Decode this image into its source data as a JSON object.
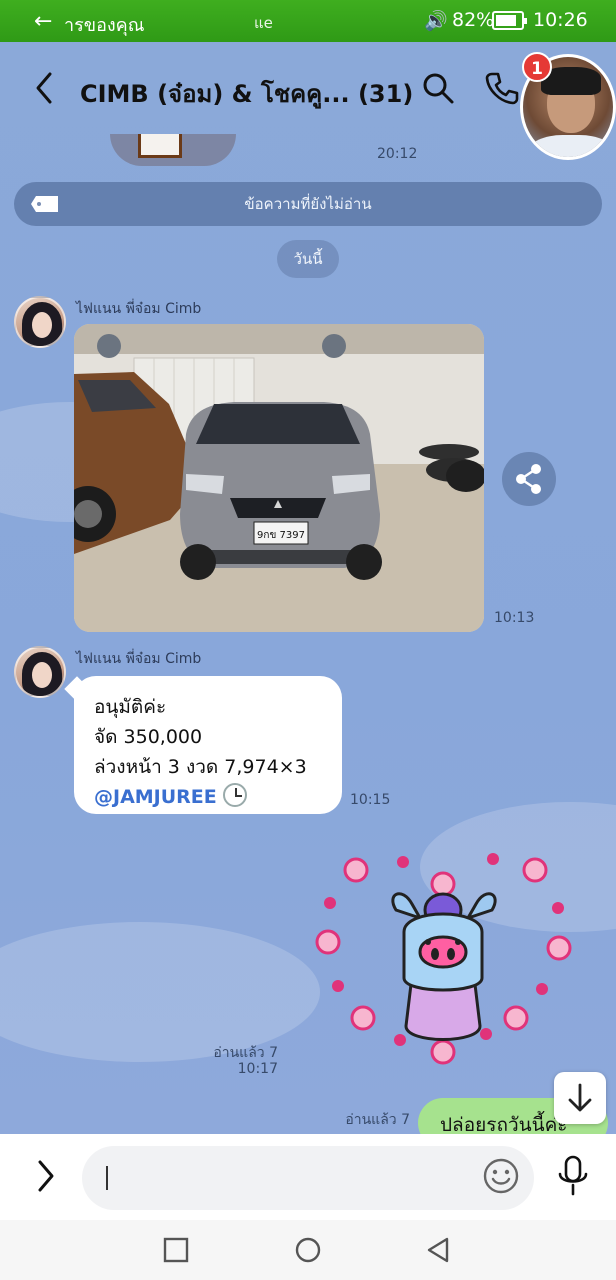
{
  "status_bar": {
    "back_label": "ารของคุณ",
    "carrier": "แe",
    "battery_pct": "82%",
    "battery_level": 0.82,
    "time": "10:26"
  },
  "header": {
    "title": "CIMB (จ๋อม) & โชคคู... (31)",
    "notification_count": "1"
  },
  "top_sticker_time": "20:12",
  "unread_bar": {
    "label": "ข้อความที่ยังไม่อ่าน"
  },
  "date_pill": {
    "label": "วันนี้"
  },
  "messages": [
    {
      "sender": "ไฟแนน พี่จ๋อม Cimb",
      "type": "photo",
      "time": "10:13",
      "plate": "9กข 7397"
    },
    {
      "sender": "ไฟแนน พี่จ๋อม Cimb",
      "type": "text",
      "lines": [
        "อนุมัติค่ะ",
        "จัด 350,000",
        "ล่วงหน้า 3 งวด 7,974×3"
      ],
      "mention": "@JAMJUREE",
      "time": "10:15"
    },
    {
      "type": "sticker",
      "read_label": "อ่านแล้ว 7",
      "time": "10:17"
    },
    {
      "type": "text",
      "text": "ปล่อยรถวันนี้ค่ะ",
      "read_label": "อ่านแล้ว 7"
    }
  ],
  "icons": {
    "back": "chevron-left-icon",
    "search": "search-icon",
    "phone": "phone-icon",
    "share": "share-icon",
    "scroll_down": "arrow-down-icon",
    "expand": "chevron-right-icon",
    "emoji": "smiley-icon",
    "mic": "microphone-icon"
  },
  "colors": {
    "status_bar": "#2f9a16",
    "chat_bg": "#8aa8d8",
    "outgoing_bubble": "#a6e28e",
    "mention": "#3a6fd0",
    "badge": "#e53935"
  }
}
